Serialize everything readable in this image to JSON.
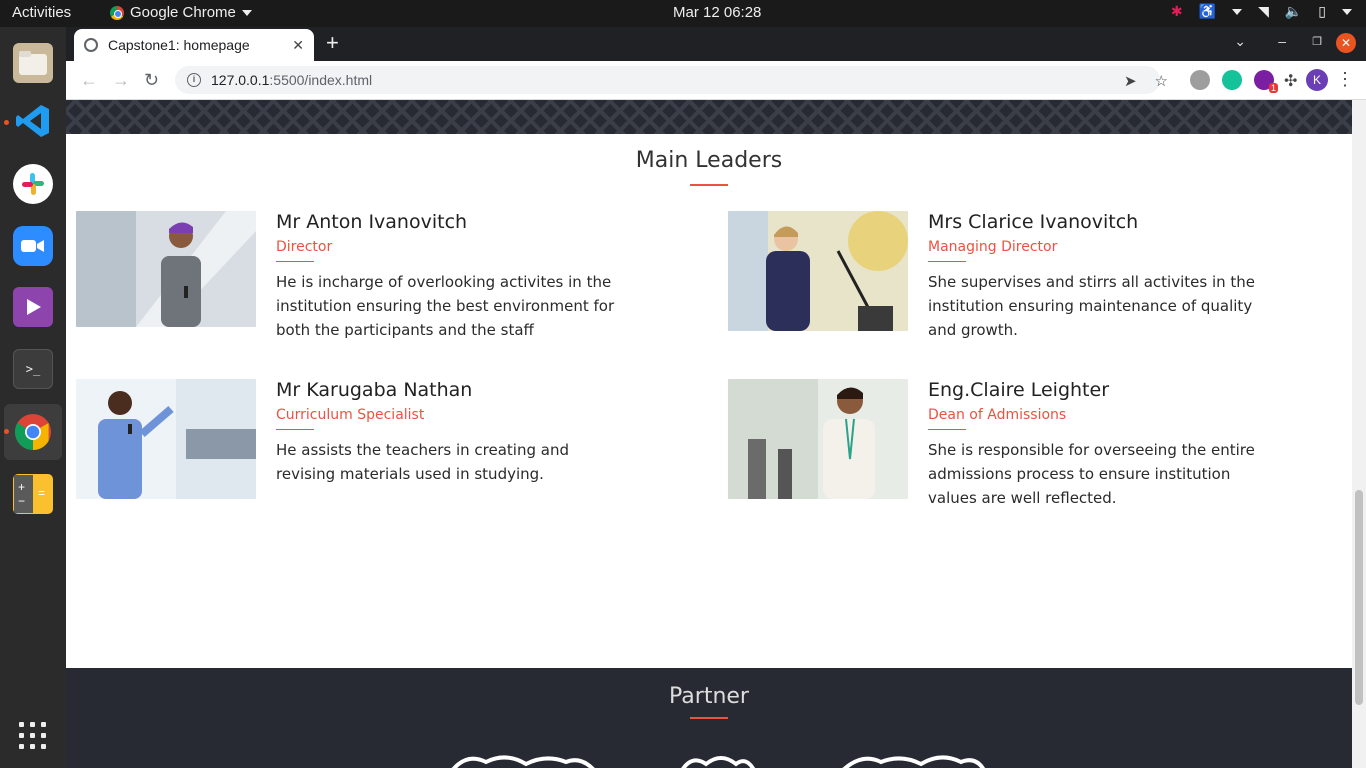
{
  "system": {
    "activities": "Activities",
    "app_name": "Google Chrome",
    "clock": "Mar 12  06:28"
  },
  "browser": {
    "tab_title": "Capstone1: homepage",
    "url_host": "127.0.0.1",
    "url_path": ":5500/index.html",
    "profile_initial": "K",
    "ext_badge": "1"
  },
  "page": {
    "leaders_title": "Main Leaders",
    "leaders": [
      {
        "name": "Mr Anton Ivanovitch",
        "role": "Director",
        "bio": "He is incharge of overlooking activites in the institution ensuring the best environment for both the participants and the staff"
      },
      {
        "name": "Mrs Clarice Ivanovitch",
        "role": "Managing Director",
        "bio": "She supervises and stirrs all activites in the institution ensuring maintenance of quality and growth."
      },
      {
        "name": "Mr Karugaba Nathan",
        "role": "Curriculum Specialist",
        "bio": "He assists the teachers in creating and revising materials used in studying."
      },
      {
        "name": "Eng.Claire Leighter",
        "role": "Dean of Admissions",
        "bio": "She is responsible for overseeing the entire admissions process to ensure institution values are well reflected."
      }
    ],
    "partner_title": "Partner"
  },
  "colors": {
    "accent": "#ec5242",
    "dark_band": "#272a33"
  }
}
